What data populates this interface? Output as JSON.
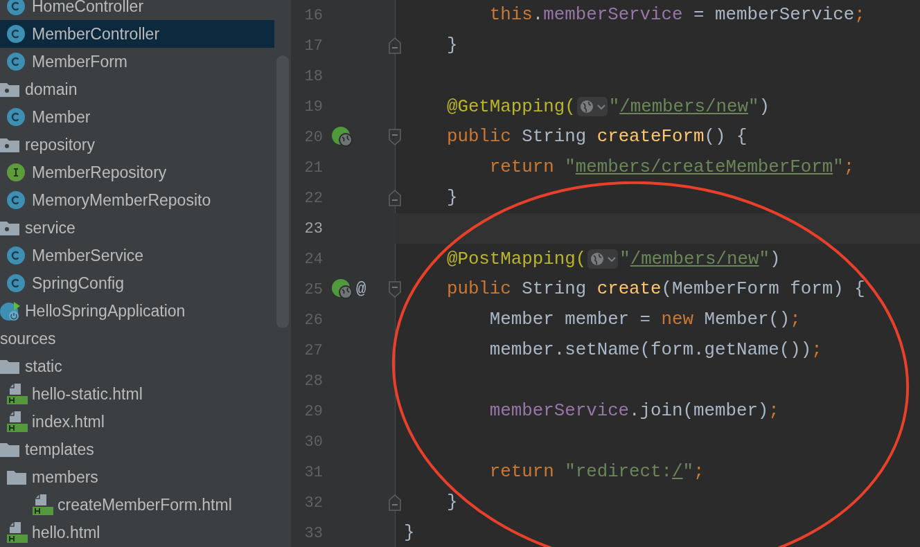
{
  "project_tree": [
    {
      "children": [
        {
          "children": [
            {
              "kind": "class",
              "label": "HomeController",
              "selected": false
            },
            {
              "kind": "class",
              "label": "MemberController",
              "selected": true
            },
            {
              "kind": "class",
              "label": "MemberForm",
              "selected": false
            }
          ]
        },
        {
          "kind": "package",
          "label": "domain",
          "selected": false,
          "children": [
            {
              "kind": "class",
              "label": "Member",
              "selected": false
            }
          ]
        },
        {
          "kind": "package",
          "label": "repository",
          "selected": false,
          "children": [
            {
              "kind": "interface",
              "label": "MemberRepository",
              "selected": false
            },
            {
              "kind": "class",
              "label": "MemoryMemberReposito",
              "selected": false
            }
          ]
        },
        {
          "kind": "package",
          "label": "service",
          "selected": false,
          "children": [
            {
              "kind": "class",
              "label": "MemberService",
              "selected": false
            },
            {
              "kind": "class",
              "label": "SpringConfig",
              "selected": false
            }
          ]
        },
        {
          "kind": "app",
          "label": "HelloSpringApplication",
          "selected": false
        }
      ]
    },
    {
      "kind": "cut",
      "label": "sources",
      "selected": false,
      "children": [
        {
          "kind": "folder",
          "label": "static",
          "selected": false,
          "children": [
            {
              "kind": "html",
              "label": "hello-static.html",
              "selected": false
            },
            {
              "kind": "html",
              "label": "index.html",
              "selected": false
            }
          ]
        },
        {
          "kind": "folder",
          "label": "templates",
          "selected": false,
          "children": [
            {
              "kind": "folder",
              "label": "members",
              "selected": false,
              "children": [
                {
                  "kind": "html",
                  "label": "createMemberForm.html",
                  "selected": false
                }
              ]
            },
            {
              "kind": "html",
              "label": "hello.html",
              "selected": false
            }
          ]
        }
      ]
    }
  ],
  "editor": {
    "lines": [
      {
        "number": "16",
        "current": false,
        "tokens": [
          {
            "kind": "kw",
            "text": "        this"
          },
          {
            "kind": "plain",
            "text": "."
          },
          {
            "kind": "field",
            "text": "memberService"
          },
          {
            "kind": "plain",
            "text": " = memberService"
          },
          {
            "kind": "kw",
            "text": ";"
          }
        ]
      },
      {
        "number": "17",
        "current": false,
        "fold": {
          "kind": "end"
        },
        "tokens": [
          {
            "kind": "plain",
            "text": "    }"
          }
        ]
      },
      {
        "number": "18",
        "current": false
      },
      {
        "number": "19",
        "current": false,
        "tokens": [
          {
            "kind": "ann",
            "text": "    @GetMapping("
          },
          {
            "kind": "inlay"
          },
          {
            "kind": "str",
            "text": "\""
          },
          {
            "kind": "url",
            "text": "/members/new"
          },
          {
            "kind": "str",
            "text": "\""
          },
          {
            "kind": "plain",
            "text": ")"
          }
        ]
      },
      {
        "number": "20",
        "current": false,
        "gutter": [
          {
            "kind": "web"
          }
        ],
        "fold": {
          "kind": "start"
        },
        "tokens": [
          {
            "kind": "kw",
            "text": "    public"
          },
          {
            "kind": "plain",
            "text": " String "
          },
          {
            "kind": "fn",
            "text": "createForm"
          },
          {
            "kind": "plain",
            "text": "() {"
          }
        ]
      },
      {
        "number": "21",
        "current": false,
        "tokens": [
          {
            "kind": "kw",
            "text": "        return"
          },
          {
            "kind": "str",
            "text": " \""
          },
          {
            "kind": "url",
            "text": "members/createMemberForm"
          },
          {
            "kind": "str",
            "text": "\""
          },
          {
            "kind": "kw",
            "text": ";"
          }
        ]
      },
      {
        "number": "22",
        "current": false,
        "fold": {
          "kind": "end"
        },
        "tokens": [
          {
            "kind": "plain",
            "text": "    }"
          }
        ]
      },
      {
        "number": "23",
        "current": true
      },
      {
        "number": "24",
        "current": false,
        "tokens": [
          {
            "kind": "ann",
            "text": "    @PostMapping("
          },
          {
            "kind": "inlay"
          },
          {
            "kind": "str",
            "text": "\""
          },
          {
            "kind": "url",
            "text": "/members/new"
          },
          {
            "kind": "str",
            "text": "\""
          },
          {
            "kind": "plain",
            "text": ")"
          }
        ]
      },
      {
        "number": "25",
        "current": false,
        "gutter": [
          {
            "kind": "web"
          },
          {
            "kind": "text",
            "text": "@"
          }
        ],
        "fold": {
          "kind": "start"
        },
        "tokens": [
          {
            "kind": "kw",
            "text": "    public"
          },
          {
            "kind": "plain",
            "text": " String "
          },
          {
            "kind": "fn",
            "text": "create"
          },
          {
            "kind": "plain",
            "text": "(MemberForm form) {"
          }
        ]
      },
      {
        "number": "26",
        "current": false,
        "tokens": [
          {
            "kind": "plain",
            "text": "        Member member = "
          },
          {
            "kind": "kw",
            "text": "new"
          },
          {
            "kind": "plain",
            "text": " Member()"
          },
          {
            "kind": "kw",
            "text": ";"
          }
        ]
      },
      {
        "number": "27",
        "current": false,
        "tokens": [
          {
            "kind": "plain",
            "text": "        member.setName(form.getName())"
          },
          {
            "kind": "kw",
            "text": ";"
          }
        ]
      },
      {
        "number": "28",
        "current": false
      },
      {
        "number": "29",
        "current": false,
        "tokens": [
          {
            "kind": "field",
            "text": "        memberService"
          },
          {
            "kind": "plain",
            "text": ".join(member)"
          },
          {
            "kind": "kw",
            "text": ";"
          }
        ]
      },
      {
        "number": "30",
        "current": false
      },
      {
        "number": "31",
        "current": false,
        "tokens": [
          {
            "kind": "kw",
            "text": "        return"
          },
          {
            "kind": "str",
            "text": " \"redirect:"
          },
          {
            "kind": "url",
            "text": "/"
          },
          {
            "kind": "str",
            "text": "\""
          },
          {
            "kind": "kw",
            "text": ";"
          }
        ]
      },
      {
        "number": "32",
        "current": false,
        "fold": {
          "kind": "end"
        },
        "tokens": [
          {
            "kind": "plain",
            "text": "    }"
          }
        ]
      },
      {
        "number": "33",
        "current": false,
        "tokens": [
          {
            "kind": "plain",
            "text": "}"
          }
        ]
      }
    ]
  }
}
